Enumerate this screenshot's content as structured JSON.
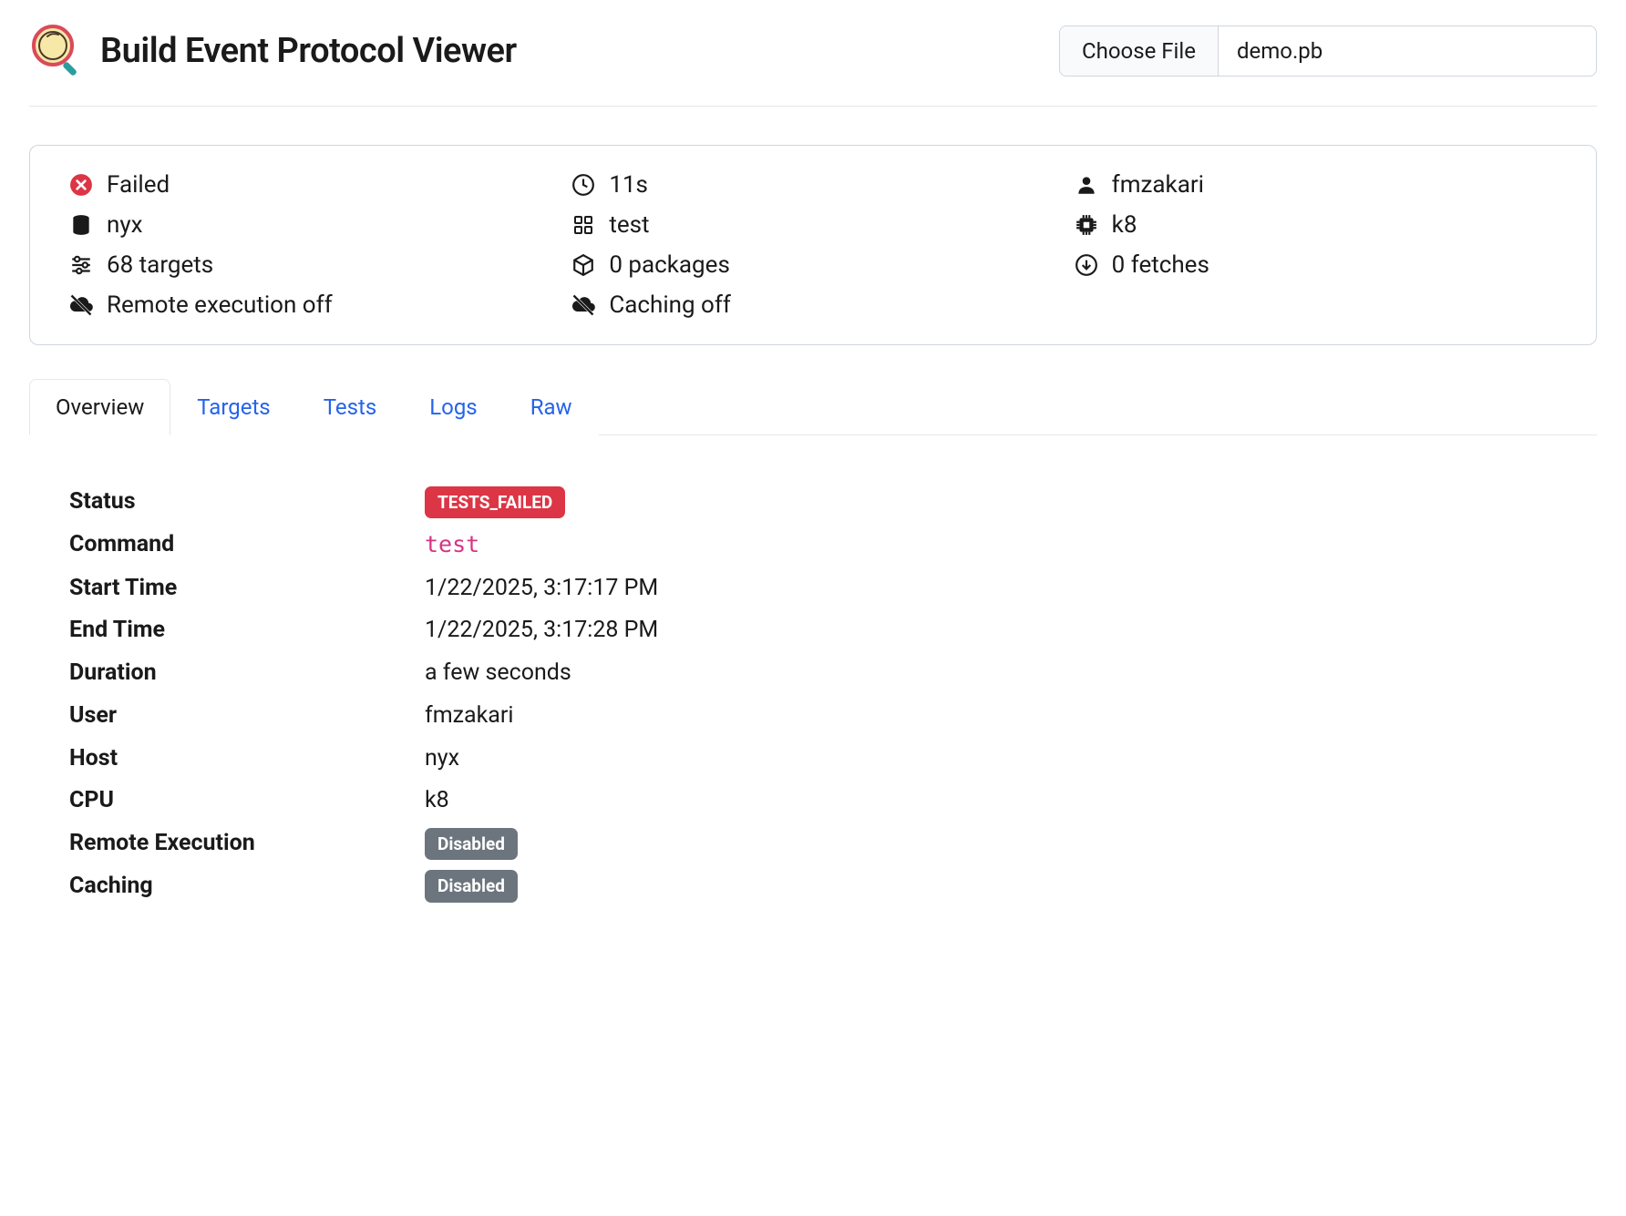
{
  "header": {
    "title": "Build Event Protocol Viewer",
    "choose_file_label": "Choose File",
    "filename": "demo.pb"
  },
  "summary": {
    "status": "Failed",
    "duration": "11s",
    "user": "fmzakari",
    "host": "nyx",
    "command": "test",
    "cpu": "k8",
    "targets": "68 targets",
    "packages": "0 packages",
    "fetches": "0 fetches",
    "remote_exec": "Remote execution off",
    "caching": "Caching off"
  },
  "tabs": {
    "overview": "Overview",
    "targets": "Targets",
    "tests": "Tests",
    "logs": "Logs",
    "raw": "Raw"
  },
  "overview": {
    "rows": {
      "status_label": "Status",
      "status_value": "TESTS_FAILED",
      "command_label": "Command",
      "command_value": "test",
      "start_label": "Start Time",
      "start_value": "1/22/2025, 3:17:17 PM",
      "end_label": "End Time",
      "end_value": "1/22/2025, 3:17:28 PM",
      "duration_label": "Duration",
      "duration_value": "a few seconds",
      "user_label": "User",
      "user_value": "fmzakari",
      "host_label": "Host",
      "host_value": "nyx",
      "cpu_label": "CPU",
      "cpu_value": "k8",
      "remote_label": "Remote Execution",
      "remote_value": "Disabled",
      "caching_label": "Caching",
      "caching_value": "Disabled"
    }
  }
}
